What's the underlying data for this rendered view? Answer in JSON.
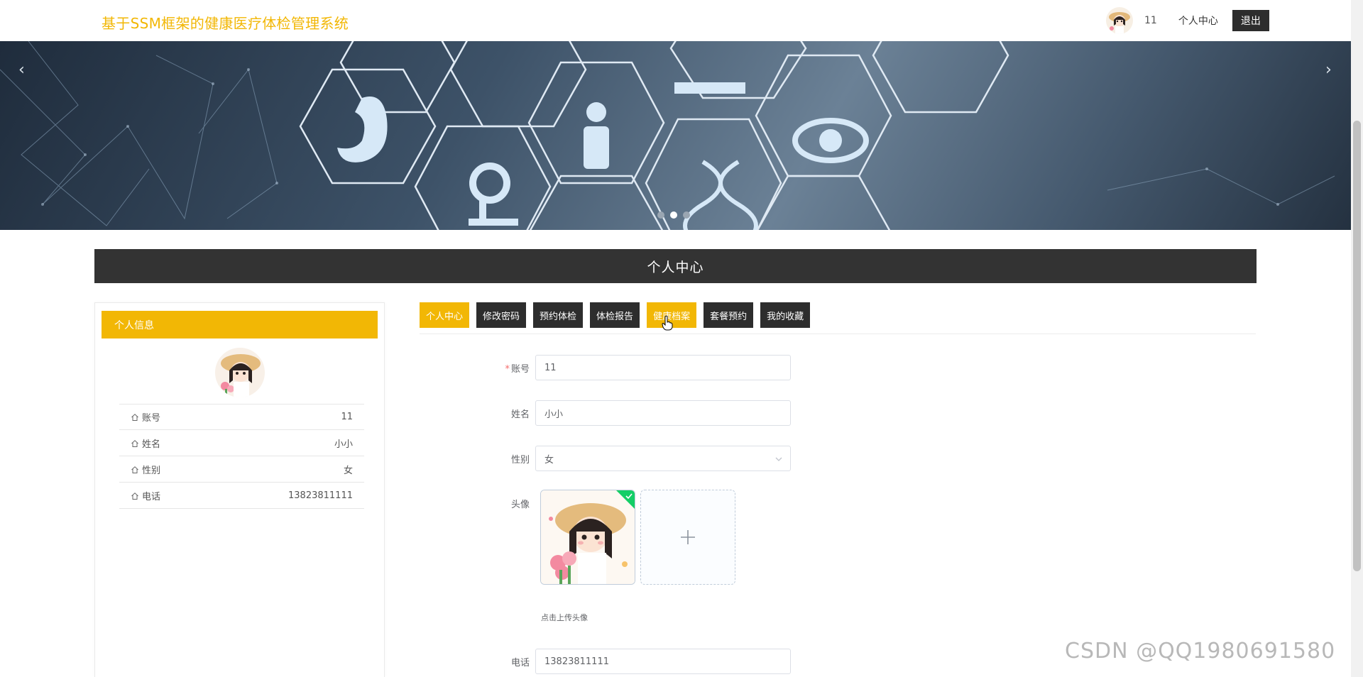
{
  "header": {
    "site_title": "基于SSM框架的健康医疗体检管理系统",
    "username": "11",
    "personal_center_link": "个人中心",
    "logout_label": "退出"
  },
  "banner": {
    "prev_arrow": "‹",
    "next_arrow": "›",
    "slide_count": 3,
    "active_slide": 1
  },
  "section": {
    "title": "个人中心"
  },
  "profile": {
    "header": "个人信息",
    "rows": [
      {
        "label": "账号",
        "value": "11"
      },
      {
        "label": "姓名",
        "value": "小小"
      },
      {
        "label": "性别",
        "value": "女"
      },
      {
        "label": "电话",
        "value": "13823811111"
      }
    ]
  },
  "tabs": [
    {
      "label": "个人中心",
      "state": "active"
    },
    {
      "label": "修改密码",
      "state": ""
    },
    {
      "label": "预约体检",
      "state": ""
    },
    {
      "label": "体检报告",
      "state": ""
    },
    {
      "label": "健康档案",
      "state": "hover"
    },
    {
      "label": "套餐预约",
      "state": ""
    },
    {
      "label": "我的收藏",
      "state": ""
    }
  ],
  "form": {
    "account_label": "账号",
    "account_required": "*",
    "account_value": "11",
    "name_label": "姓名",
    "name_value": "小小",
    "gender_label": "性别",
    "gender_value": "女",
    "avatar_label": "头像",
    "upload_tip": "点击上传头像",
    "phone_label": "电话",
    "phone_value": "13823811111"
  },
  "watermark": "CSDN @QQ1980691580",
  "colors": {
    "accent": "#f2b705",
    "dark": "#2d2d2d",
    "section_bar": "#333333",
    "success": "#13ce66"
  }
}
